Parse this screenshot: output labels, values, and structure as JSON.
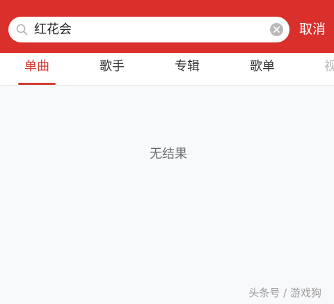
{
  "search": {
    "value": "红花会",
    "cancel_label": "取消",
    "icon": "search-icon",
    "clear_icon": "clear-icon"
  },
  "tabs": [
    {
      "label": "单曲",
      "active": true
    },
    {
      "label": "歌手",
      "active": false
    },
    {
      "label": "专辑",
      "active": false
    },
    {
      "label": "歌单",
      "active": false
    },
    {
      "label": "视",
      "active": false
    }
  ],
  "content": {
    "empty_message": "无结果"
  },
  "watermark": "头条号 / 游戏狗",
  "colors": {
    "brand_red": "#d9302c",
    "active_tab": "#d33a31",
    "background": "#f8f9fb"
  }
}
